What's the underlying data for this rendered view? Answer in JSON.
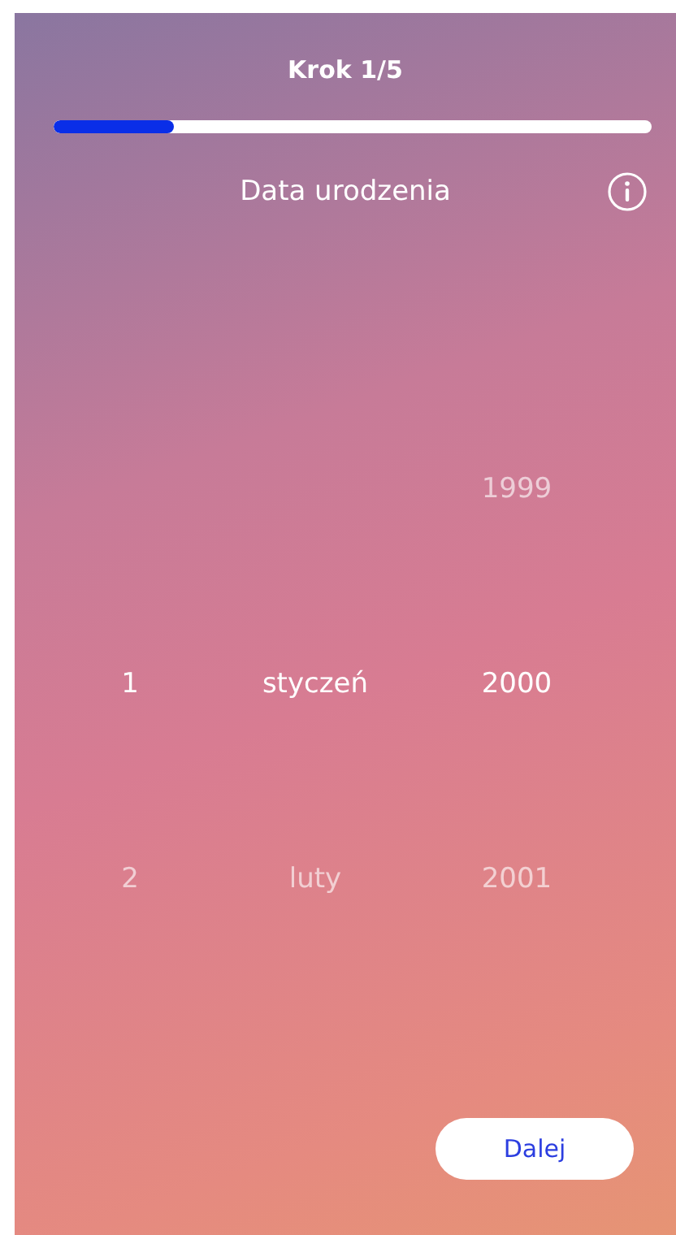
{
  "header": {
    "title": "Krok 1/5",
    "progress": {
      "level": 0.2
    }
  },
  "question": {
    "label": "Data urodzenia"
  },
  "picker": {
    "columns": [
      {
        "kind": "day",
        "items": [
          {
            "label": "1",
            "selected": true
          },
          {
            "label": "2",
            "selected": false
          }
        ]
      },
      {
        "kind": "month",
        "items": [
          {
            "label": "styczeń",
            "selected": true
          },
          {
            "label": "luty",
            "selected": false
          }
        ]
      },
      {
        "kind": "year",
        "items": [
          {
            "label": "1999",
            "selected": false
          },
          {
            "label": "2000",
            "selected": true
          },
          {
            "label": "2001",
            "selected": false
          }
        ]
      }
    ]
  },
  "next_button": {
    "label": "Dalej"
  }
}
